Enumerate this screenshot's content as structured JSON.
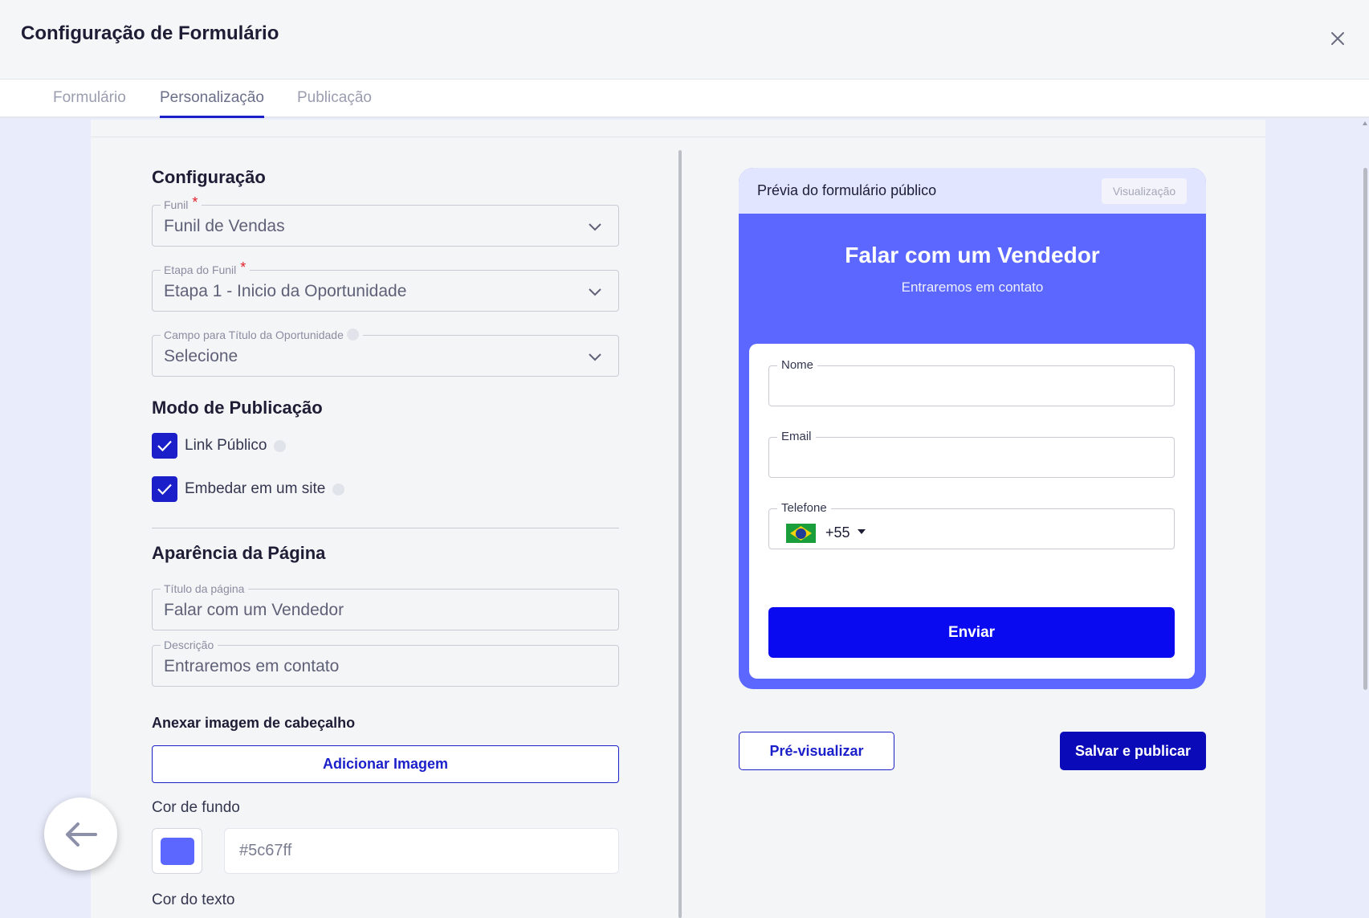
{
  "modal": {
    "title": "Configuração de Formulário"
  },
  "tabs": [
    {
      "label": "Formulário",
      "active": false
    },
    {
      "label": "Personalização",
      "active": true
    },
    {
      "label": "Publicação",
      "active": false
    }
  ],
  "config": {
    "title": "Configuração",
    "funil": {
      "label": "Funil",
      "value": "Funil de Vendas",
      "required": true
    },
    "etapa": {
      "label": "Etapa do Funil",
      "value": "Etapa 1 - Inicio da Oportunidade",
      "required": true
    },
    "campo_titulo": {
      "label": "Campo para Título da Oportunidade",
      "value": "Selecione"
    }
  },
  "publicacao": {
    "title": "Modo de Publicação",
    "options": [
      {
        "label": "Link Público",
        "checked": true
      },
      {
        "label": "Embedar em um site",
        "checked": true
      }
    ]
  },
  "aparencia": {
    "title": "Aparência da Página",
    "titulo_pagina": {
      "label": "Título da página",
      "value": "Falar com um Vendedor"
    },
    "descricao": {
      "label": "Descrição",
      "value": "Entraremos em contato"
    },
    "anexar_label": "Anexar imagem de cabeçalho",
    "add_image_label": "Adicionar Imagem",
    "cor_fundo_label": "Cor de fundo",
    "cor_fundo_value": "#5c67ff",
    "cor_texto_label": "Cor do texto"
  },
  "preview": {
    "header_title": "Prévia do formulário público",
    "badge": "Visualização",
    "title": "Falar com um Vendedor",
    "description": "Entraremos em contato",
    "fields": [
      {
        "label": "Nome"
      },
      {
        "label": "Email"
      },
      {
        "label": "Telefone",
        "dial_code": "+55",
        "flag": "brazil-flag-icon"
      }
    ],
    "submit_label": "Enviar",
    "background_color": "#5c67ff"
  },
  "actions": {
    "preview_label": "Pré-visualizar",
    "publish_label": "Salvar e publicar"
  },
  "colors": {
    "accent": "#1a1fc9",
    "submit": "#0a0af0",
    "preview_bg": "#5c67ff"
  }
}
